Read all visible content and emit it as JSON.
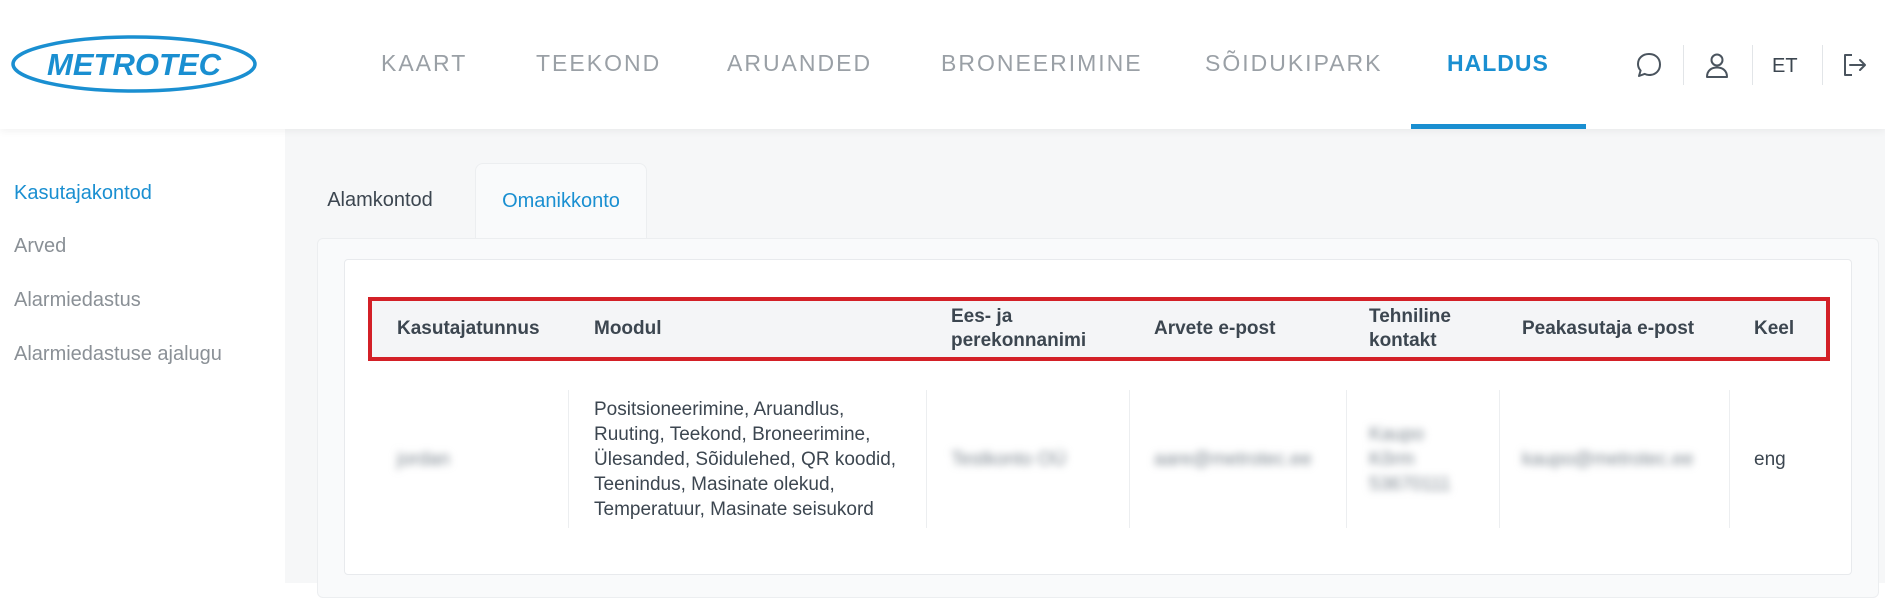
{
  "brand": {
    "logo_text": "METROTEC",
    "accent": "#1a8fd1",
    "logo_color": "#1a8fd1"
  },
  "nav": {
    "items": [
      {
        "label": "KAART"
      },
      {
        "label": "TEEKOND"
      },
      {
        "label": "ARUANDED"
      },
      {
        "label": "BRONEERIMINE"
      },
      {
        "label": "SÕIDUKIPARK"
      },
      {
        "label": "HALDUS",
        "active": true
      }
    ]
  },
  "header": {
    "icons": [
      "chat-icon",
      "user-icon",
      "logout-icon"
    ],
    "language": "ET"
  },
  "sidebar": {
    "items": [
      {
        "label": "Kasutajakontod",
        "active": true
      },
      {
        "label": "Arved"
      },
      {
        "label": "Alarmiedastus"
      },
      {
        "label": "Alarmiedastuse ajalugu"
      }
    ]
  },
  "tabs": [
    {
      "label": "Alamkontod"
    },
    {
      "label": "Omanikkonto",
      "active": true
    }
  ],
  "table": {
    "columns": [
      "Kasutajatunnus",
      "Moodul",
      "Ees- ja perekonnanimi",
      "Arvete e-post",
      "Tehniline kontakt",
      "Peakasutaja e-post",
      "Keel"
    ],
    "rows": [
      {
        "username": "jordan",
        "modules": "Positsioneerimine, Aruandlus, Ruuting, Teekond, Broneerimine, Ülesanded, Sõidulehed, QR koodid, Teenindus, Masinate olekud, Temperatuur, Masinate seisukord",
        "name": "Testkonto OÜ",
        "billing_email": "aare@metrotec.ee",
        "tech_contact": "Kaupo Kõrm 53670111",
        "admin_email": "kaupo@metrotec.ee",
        "language": "eng"
      }
    ]
  }
}
